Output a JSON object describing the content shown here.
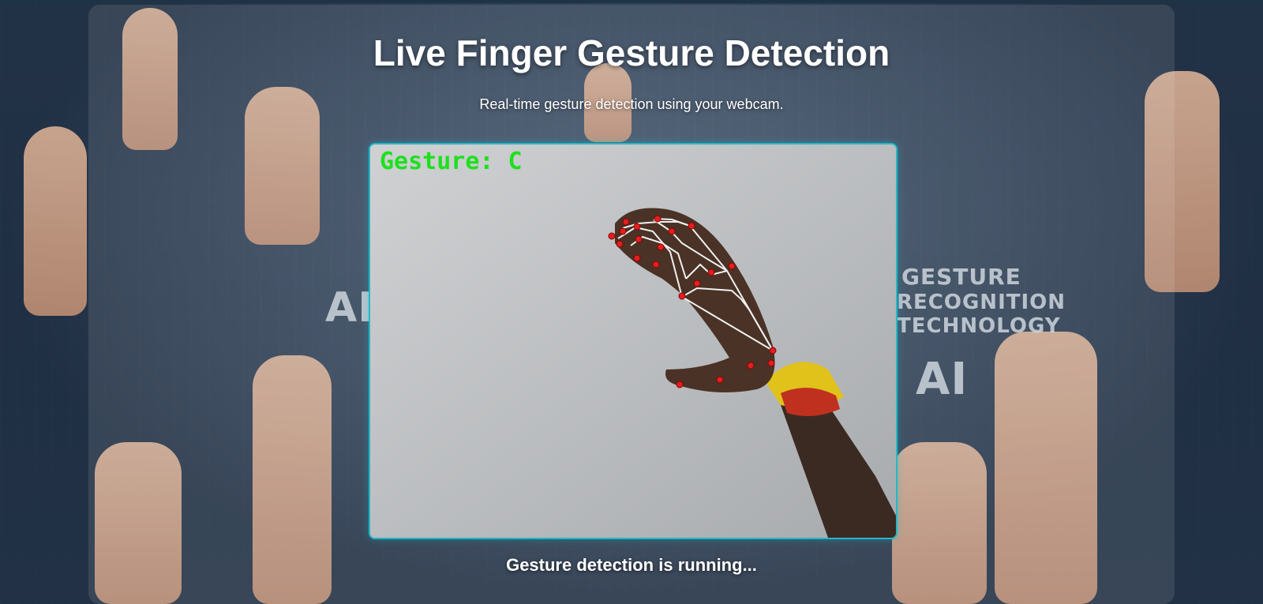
{
  "page": {
    "title": "Live Finger Gesture Detection",
    "subtitle": "Real-time gesture detection using your webcam.",
    "status": "Gesture detection is running..."
  },
  "video": {
    "gesture_text": "Gesture: C",
    "accent_color": "#22b8c8",
    "label_color": "#1ee01e",
    "landmark_color": "#e02020"
  },
  "background": {
    "text_1": "GESTURE",
    "text_2": "RECOGNITION",
    "text_3": "TECHNOLOGY",
    "text_4": "AI",
    "text_5": "AI"
  }
}
